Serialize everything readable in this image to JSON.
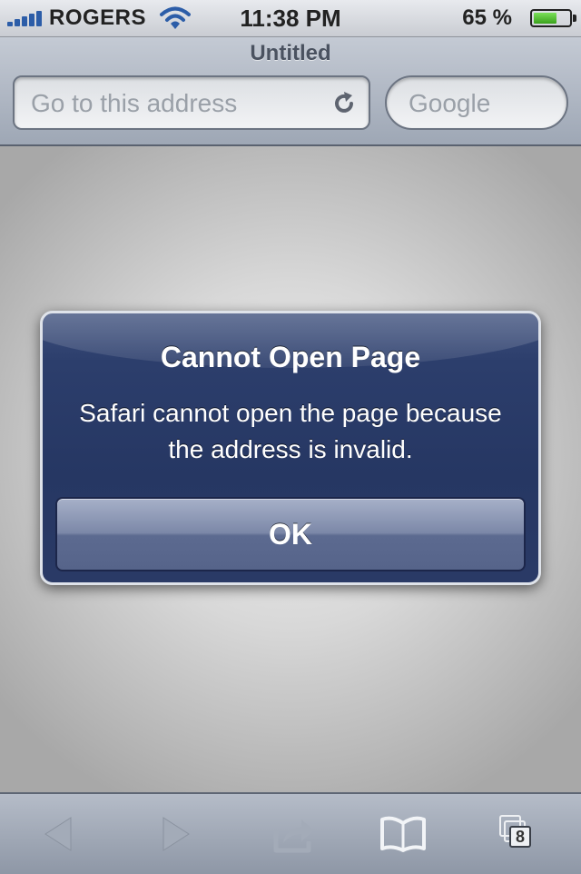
{
  "status_bar": {
    "carrier": "ROGERS",
    "time": "11:38 PM",
    "battery_percent": "65 %",
    "battery_level": 0.65,
    "icons": [
      "signal-icon",
      "wifi-icon",
      "battery-icon"
    ]
  },
  "browser": {
    "page_title": "Untitled",
    "address_placeholder": "Go to this address",
    "search_placeholder": "Google",
    "icons": [
      "reload-icon"
    ]
  },
  "alert": {
    "title": "Cannot Open Page",
    "message": "Safari cannot open the page because the address is invalid.",
    "ok_label": "OK"
  },
  "toolbar": {
    "tabs_count": "8",
    "icons": [
      "back-icon",
      "forward-icon",
      "share-icon",
      "bookmarks-icon",
      "pages-icon"
    ]
  },
  "colors": {
    "alert_background": "#263763",
    "toolbar_background": "#a0a8b6",
    "signal_blue": "#2c5da8"
  }
}
